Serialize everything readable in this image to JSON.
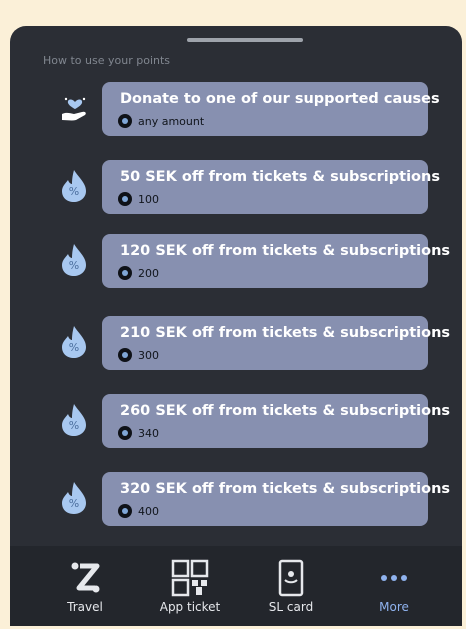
{
  "section": {
    "title": "How to use your points"
  },
  "rewards": [
    {
      "title": "Donate to one of our supported causes",
      "points": "any amount",
      "icon": "donate-heart-hand-icon"
    },
    {
      "title": "50 SEK off from tickets & subscriptions",
      "points": "100",
      "icon": "discount-drop-icon"
    },
    {
      "title": "120 SEK off from tickets & subscriptions",
      "points": "200",
      "icon": "discount-drop-icon"
    },
    {
      "title": "210 SEK off from tickets & subscriptions",
      "points": "300",
      "icon": "discount-drop-icon"
    },
    {
      "title": "260 SEK off from tickets & subscriptions",
      "points": "340",
      "icon": "discount-drop-icon"
    },
    {
      "title": "320 SEK off from tickets & subscriptions",
      "points": "400",
      "icon": "discount-drop-icon"
    }
  ],
  "nav": {
    "items": [
      {
        "label": "Travel",
        "icon": "travel-z-icon"
      },
      {
        "label": "App ticket",
        "icon": "qr-code-icon"
      },
      {
        "label": "SL card",
        "icon": "sl-card-icon"
      },
      {
        "label": "More",
        "icon": "more-dots-icon",
        "active": true
      }
    ]
  },
  "colors": {
    "sheet": "#2b2e35",
    "card": "#8790b0",
    "accent": "#8fb2ee",
    "background": "#fbf0d8"
  }
}
